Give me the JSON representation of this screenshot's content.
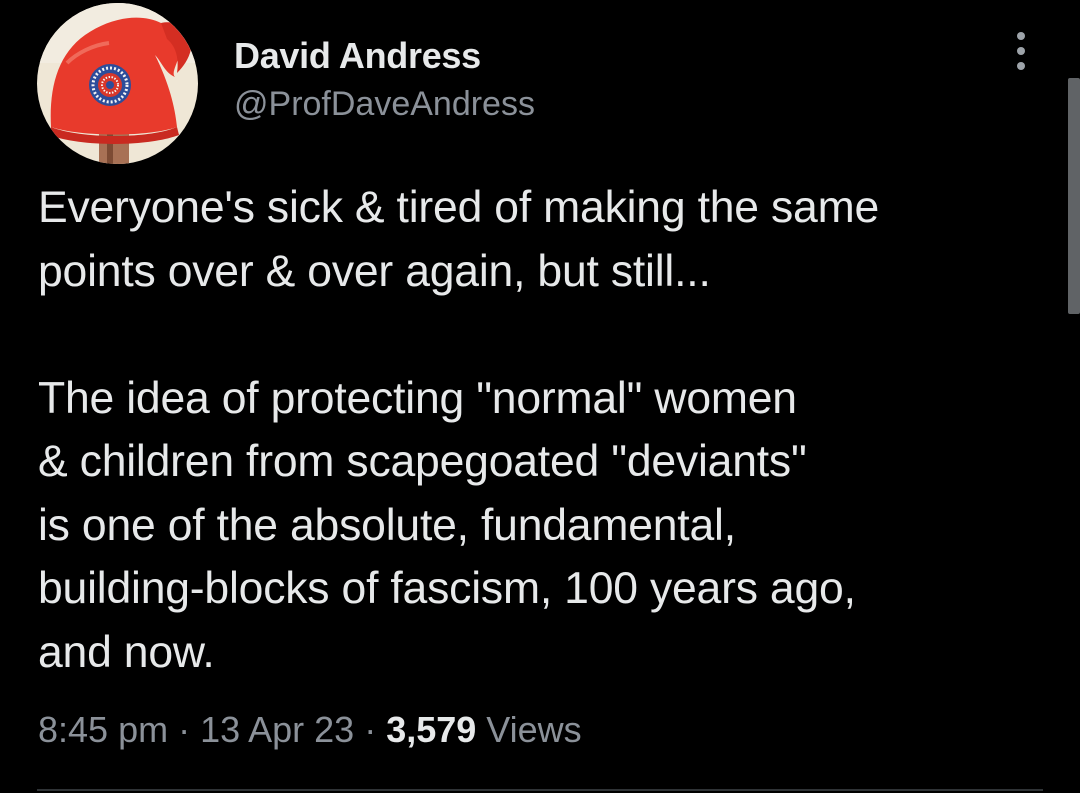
{
  "author": {
    "display_name": "David Andress",
    "handle": "@ProfDaveAndress",
    "avatar_icon": "red-phrygian-cap-cockade-icon"
  },
  "tweet": {
    "text": "Everyone's sick & tired of making the same\npoints over & over again, but still...\n\nThe idea of protecting \"normal\" women\n& children from scapegoated \"deviants\"\nis one of the absolute, fundamental,\nbuilding-blocks of fascism, 100 years ago,\nand now."
  },
  "meta": {
    "time": "8:45 pm",
    "separator": " · ",
    "date": "13 Apr 23",
    "views_count": "3,579",
    "views_label": " Views"
  },
  "menu": {
    "icon": "more-options-icon"
  },
  "colors": {
    "background": "#000000",
    "primary_text": "#e7e9ea",
    "secondary_text": "#8b9199",
    "avatar_cap": "#e83a2c"
  }
}
